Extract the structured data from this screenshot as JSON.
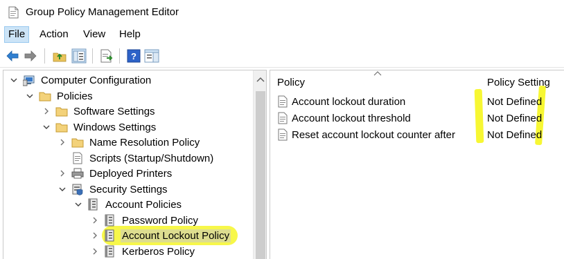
{
  "window": {
    "title": "Group Policy Management Editor"
  },
  "menu": {
    "items": [
      "File",
      "Action",
      "View",
      "Help"
    ]
  },
  "tree": {
    "root": "Computer Configuration",
    "policies": "Policies",
    "software_settings": "Software Settings",
    "windows_settings": "Windows Settings",
    "name_resolution_policy": "Name Resolution Policy",
    "scripts": "Scripts (Startup/Shutdown)",
    "deployed_printers": "Deployed Printers",
    "security_settings": "Security Settings",
    "account_policies": "Account Policies",
    "password_policy": "Password Policy",
    "account_lockout_policy": "Account Lockout Policy",
    "kerberos_policy": "Kerberos Policy"
  },
  "list": {
    "columns": {
      "policy": "Policy",
      "setting": "Policy Setting"
    },
    "rows": [
      {
        "policy": "Account lockout duration",
        "setting": "Not Defined"
      },
      {
        "policy": "Account lockout threshold",
        "setting": "Not Defined"
      },
      {
        "policy": "Reset account lockout counter after",
        "setting": "Not Defined"
      }
    ]
  },
  "colors": {
    "highlight": "#f6f62a",
    "selection": "#cce4f7",
    "folder": "#e8c35a"
  },
  "icons": [
    "gpo-editor-icon",
    "back-icon",
    "forward-icon",
    "up-folder-icon",
    "show-hide-tree-icon",
    "export-list-icon",
    "help-icon",
    "show-action-pane-icon"
  ]
}
